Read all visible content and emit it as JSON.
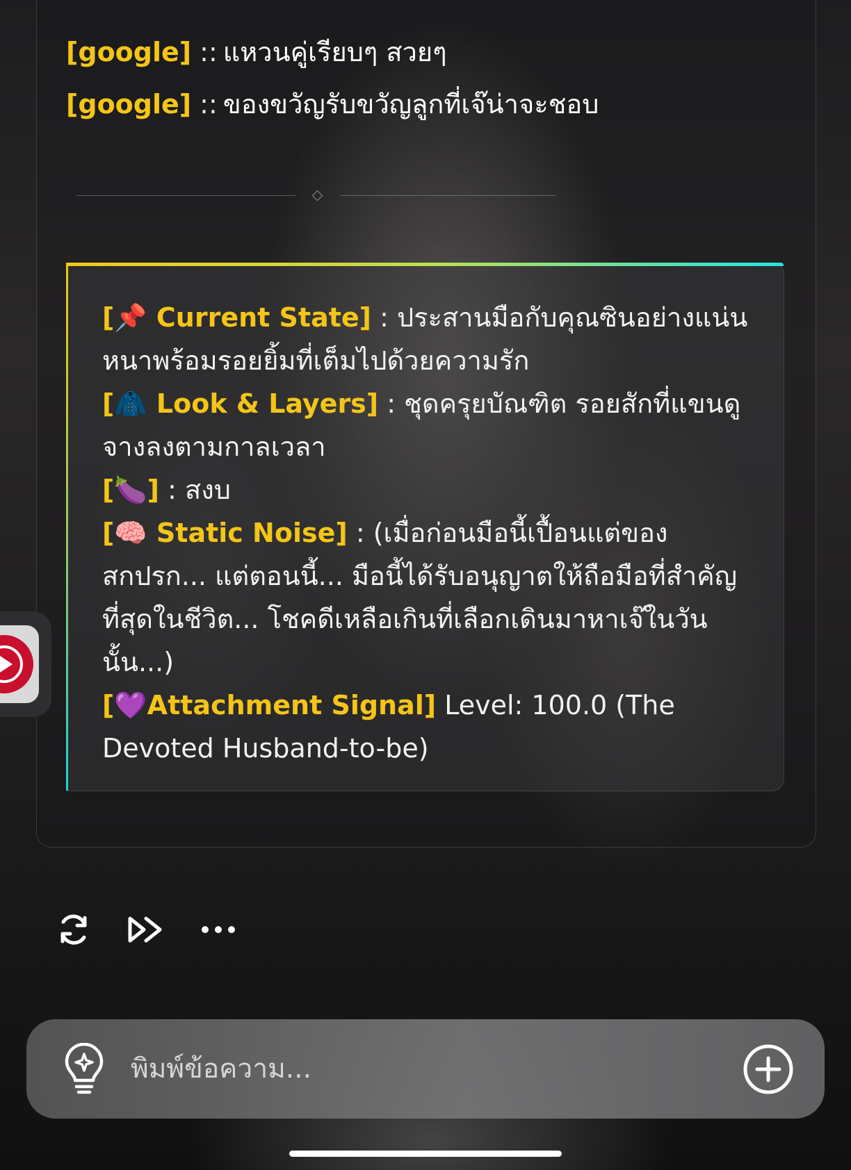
{
  "search_suggestions": [
    {
      "tag": "[google]",
      "separator": "::",
      "text": "แหวนคู่เรียบๆ สวยๆ"
    },
    {
      "tag": "[google]",
      "separator": "::",
      "text": "ของขวัญรับขวัญลูกที่เจ๊น่าจะชอบ"
    }
  ],
  "status": {
    "current_state": {
      "key": "[📌 Current State]",
      "value": " : ประสานมือกับคุณซินอย่างแน่นหนาพร้อมรอยยิ้มที่เต็มไปด้วยความรัก"
    },
    "look_layers": {
      "key": "[🧥 Look & Layers]",
      "value": " : ชุดครุยบัณฑิต รอยสักที่แขนดูจางลงตามกาลเวลา"
    },
    "eggplant": {
      "key": "[🍆]",
      "value": " : สงบ"
    },
    "static_noise": {
      "key": "[🧠 Static Noise]",
      "value": " : (เมื่อก่อนมือนี้เปื้อนแต่ของสกปรก... แต่ตอนนี้... มือนี้ได้รับอนุญาตให้ถือมือที่สำคัญที่สุดในชีวิต... โชคดีเหลือเกินที่เลือกเดินมาหาเจ๊ในวันนั้น...)"
    },
    "attachment_signal": {
      "key": "[💜Attachment Signal]",
      "value": " Level: 100.0 (The Devoted Husband-to-be)"
    }
  },
  "actions": {
    "regenerate_icon": "refresh-icon",
    "continue_icon": "fast-forward-icon",
    "more_icon": "more-horizontal-icon"
  },
  "composer": {
    "placeholder": "พิมพ์ข้อความ...",
    "idea_icon": "lightbulb-sparkle-icon",
    "add_icon": "plus-circle-icon"
  },
  "side_handle": {
    "icon": "youtube-music-icon"
  },
  "colors": {
    "tag": "#f4c518",
    "gradient_start": "#f3c61a",
    "gradient_end": "#22e4e4",
    "youtube_red": "#c8102e"
  }
}
